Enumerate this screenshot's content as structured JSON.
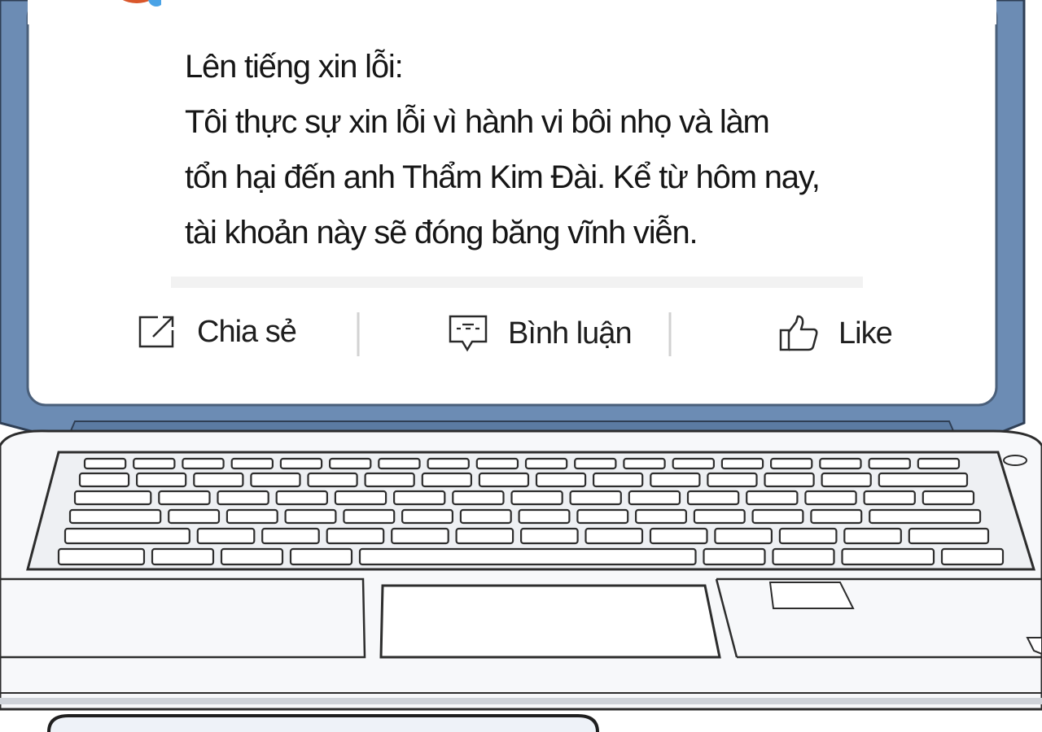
{
  "post": {
    "lines": [
      "Lên tiếng xin lỗi:",
      "Tôi thực sự xin lỗi vì hành vi bôi nhọ và làm",
      "tổn hại đến anh Thẩm Kim Đài. Kể từ hôm nay,",
      "tài khoản này sẽ đóng băng vĩnh viễn."
    ]
  },
  "actions": {
    "share": {
      "label": "Chia sẻ",
      "icon": "share-icon"
    },
    "comment": {
      "label": "Bình luận",
      "icon": "comment-icon"
    },
    "like": {
      "label": "Like",
      "icon": "thumbs-up-icon"
    }
  },
  "colors": {
    "laptop_bezel": "#6c8cb4",
    "screen": "#ffffff",
    "outline": "#3a3a3a",
    "avatar": "#d9572b",
    "verified_badge": "#4aa3e6"
  }
}
